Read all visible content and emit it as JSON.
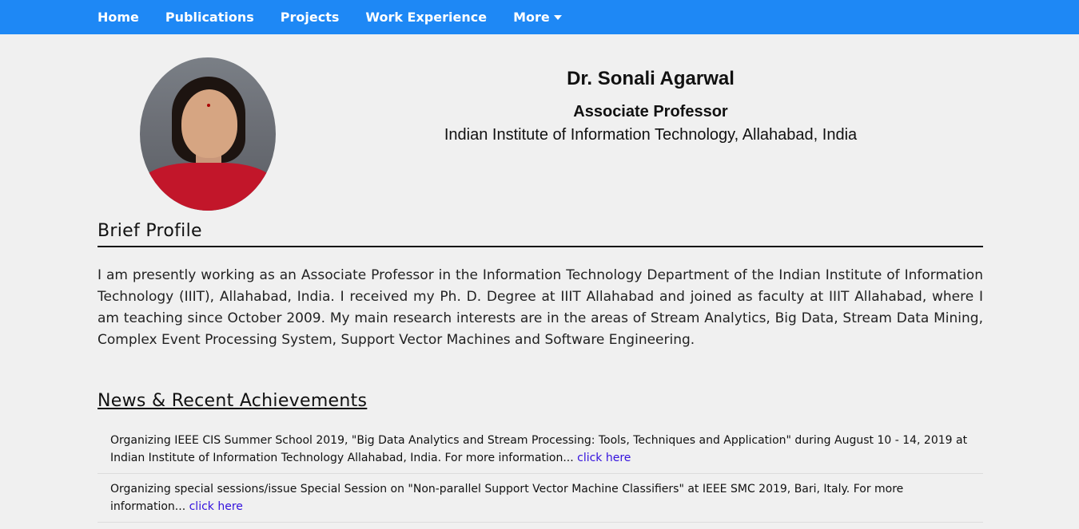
{
  "nav": {
    "items": [
      {
        "label": "Home"
      },
      {
        "label": "Publications"
      },
      {
        "label": "Projects"
      },
      {
        "label": "Work Experience"
      },
      {
        "label": "More"
      }
    ]
  },
  "header": {
    "name": "Dr. Sonali Agarwal",
    "position": "Associate Professor",
    "institute": "Indian Institute of Information Technology, Allahabad, India"
  },
  "profile": {
    "title": "Brief Profile",
    "text": "I am presently working as an Associate Professor in the Information Technology Department of the Indian Institute of Information Technology (IIIT), Allahabad, India. I received my Ph. D. Degree at IIIT Allahabad and joined as faculty at IIIT Allahabad, where I am teaching since October 2009. My main research interests are in the areas of Stream Analytics, Big Data, Stream Data Mining, Complex Event Processing System, Support Vector Machines and Software Engineering."
  },
  "news": {
    "title": "News & Recent Achievements",
    "items": [
      {
        "text": "Organizing IEEE CIS Summer School 2019, \"Big Data Analytics and Stream Processing: Tools, Techniques and Application\" during August 10 - 14, 2019 at Indian Institute of Information Technology Allahabad, India. For more information... ",
        "link": "click here"
      },
      {
        "text": "Organizing special sessions/issue Special Session on \"Non-parallel Support Vector Machine Classifiers\" at IEEE SMC 2019, Bari, Italy. For more information... ",
        "link": "click here"
      }
    ]
  },
  "colors": {
    "navbar": "#1e88f5",
    "background": "#f0f0f0",
    "link": "#3311dd"
  }
}
